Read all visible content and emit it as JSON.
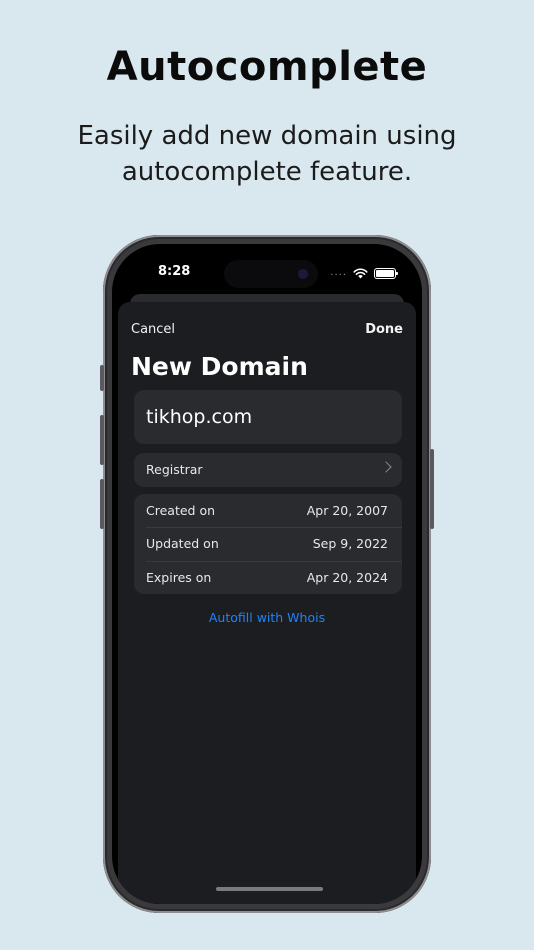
{
  "promo": {
    "headline": "Autocomplete",
    "subhead_line1": "Easily add new domain using",
    "subhead_line2": "autocomplete feature."
  },
  "status_bar": {
    "time": "8:28",
    "dots": "....",
    "wifi_icon": "wifi-icon",
    "battery_icon": "battery-icon"
  },
  "nav": {
    "cancel_label": "Cancel",
    "done_label": "Done"
  },
  "sheet": {
    "title": "New Domain"
  },
  "domain_field": {
    "value": "tikhop.com"
  },
  "registrar": {
    "label": "Registrar",
    "chevron_icon": "chevron-right-icon"
  },
  "dates": [
    {
      "label": "Created on",
      "value": "Apr 20, 2007"
    },
    {
      "label": "Updated on",
      "value": "Sep 9, 2022"
    },
    {
      "label": "Expires on",
      "value": "Apr 20, 2024"
    }
  ],
  "autofill_label": "Autofill with Whois",
  "colors": {
    "background": "#d9e8ee",
    "sheet": "#1c1d20",
    "card": "#2a2b2f",
    "accent": "#1b84ff"
  }
}
